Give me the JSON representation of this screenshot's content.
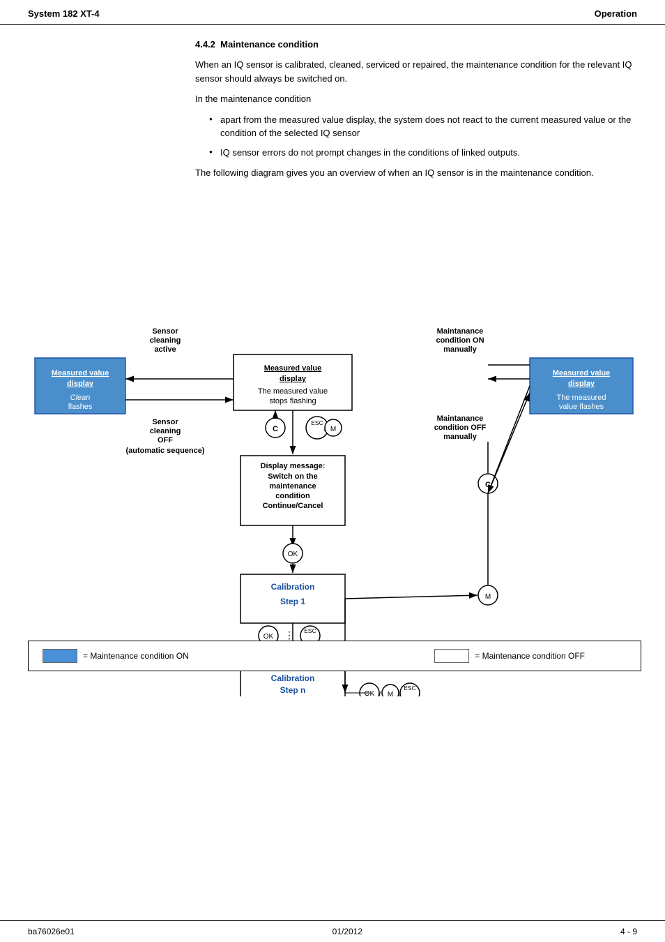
{
  "header": {
    "left": "System 182 XT-4",
    "right": "Operation"
  },
  "footer": {
    "left": "ba76026e01",
    "center": "01/2012",
    "right": "4 - 9"
  },
  "section": {
    "number": "4.4.2",
    "title": "Maintenance condition",
    "intro1": "When an IQ sensor is calibrated, cleaned, serviced or repaired, the maintenance condition for the relevant IQ sensor should always be switched on.",
    "intro2": "In the maintenance condition",
    "bullet1": "apart from the measured value display, the system does not react to the current measured value or the condition of the selected IQ sensor",
    "bullet2": "IQ sensor errors do not prompt changes in the conditions of linked outputs.",
    "intro3": "The following diagram gives you an overview of when an IQ sensor is in the maintenance condition."
  },
  "diagram": {
    "boxes": {
      "mvd_left_title": "Measured value display",
      "mvd_left_sub": "Clean flashes",
      "sensor_cleaning_active": "Sensor cleaning active",
      "sensor_cleaning_off": "Sensor cleaning OFF (automatic sequence)",
      "mvd_center_title": "Measured value display",
      "mvd_center_sub": "The measured value stops flashing",
      "display_msg_title": "Display message:",
      "display_msg_body": "Switch on the maintenance condition Continue/Cancel",
      "calib_step1_title": "Calibration",
      "calib_step1_sub": "Step 1",
      "calib_stepn_title": "Calibration",
      "calib_stepn_sub": "Step n End",
      "maintenance_on": "Maintanance condition ON manually",
      "mvd_right_title": "Measured value display",
      "mvd_right_sub": "The measured value flashes",
      "maintenance_off": "Maintanance condition OFF manually"
    },
    "legend": {
      "blue_label": "= Maintenance condition ON",
      "white_label": "= Maintenance condition OFF"
    }
  }
}
